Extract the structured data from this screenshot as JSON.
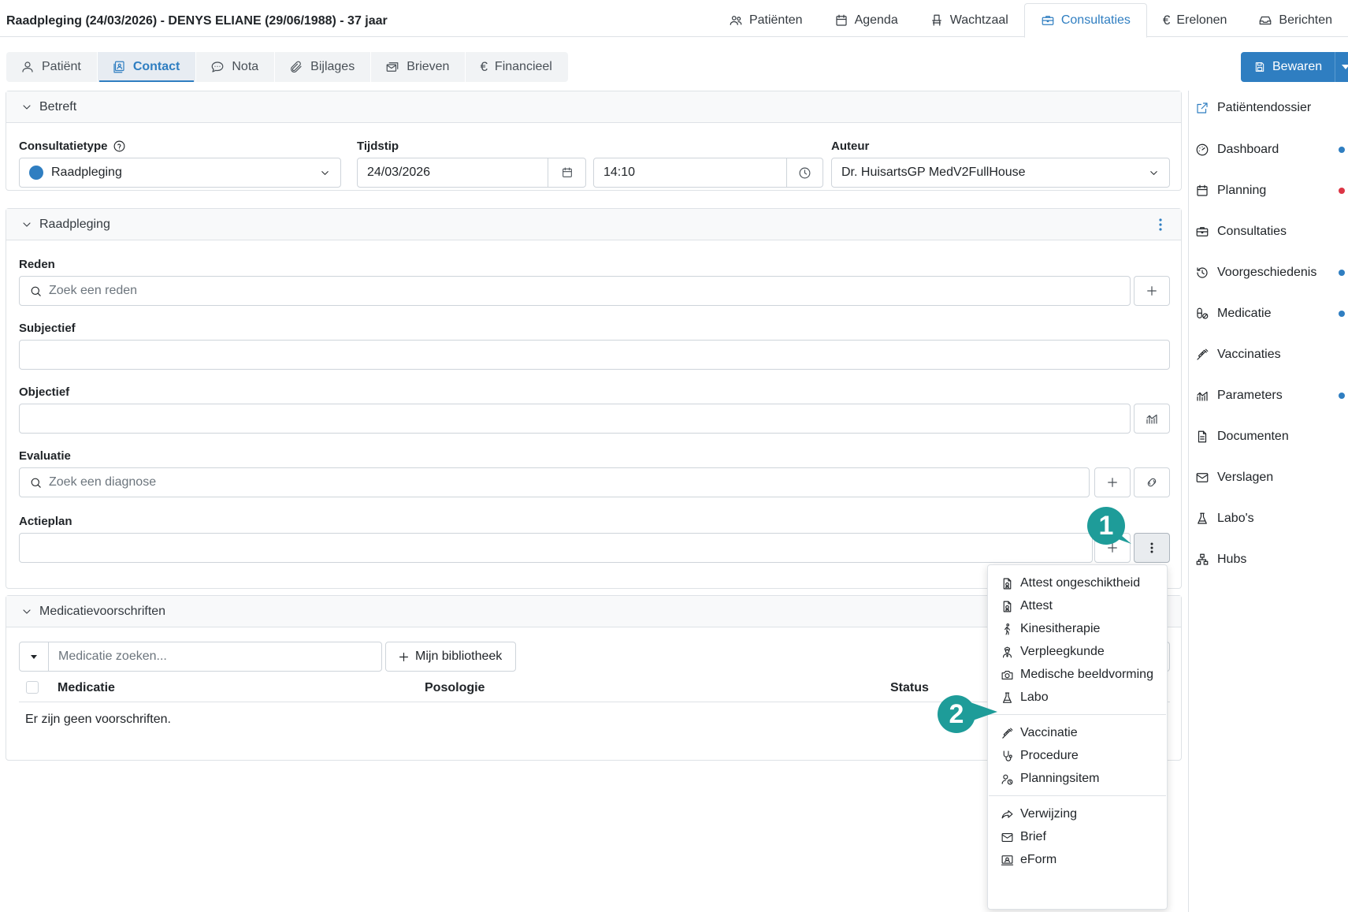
{
  "header": {
    "title": "Raadpleging (24/03/2026) - DENYS ELIANE (29/06/1988) - 37 jaar",
    "nav": [
      {
        "label": "Patiënten",
        "icon": "users-icon"
      },
      {
        "label": "Agenda",
        "icon": "calendar-icon"
      },
      {
        "label": "Wachtzaal",
        "icon": "chair-icon"
      },
      {
        "label": "Consultaties",
        "icon": "briefcase-icon",
        "active": true
      },
      {
        "label": "Erelonen",
        "icon": "euro-icon"
      },
      {
        "label": "Berichten",
        "icon": "inbox-icon"
      }
    ]
  },
  "tabs": [
    {
      "label": "Patiënt",
      "icon": "user-icon"
    },
    {
      "label": "Contact",
      "icon": "contact-icon",
      "active": true
    },
    {
      "label": "Nota",
      "icon": "chat-icon"
    },
    {
      "label": "Bijlages",
      "icon": "paperclip-icon"
    },
    {
      "label": "Brieven",
      "icon": "letters-icon"
    },
    {
      "label": "Financieel",
      "icon": "euro-icon"
    }
  ],
  "save": {
    "label": "Bewaren"
  },
  "betreft": {
    "title": "Betreft",
    "consultatietype_label": "Consultatietype",
    "consultatietype_value": "Raadpleging",
    "consultatietype_color": "#2f7ec1",
    "tijdstip_label": "Tijdstip",
    "date_value": "24/03/2026",
    "time_value": "14:10",
    "auteur_label": "Auteur",
    "auteur_value": "Dr. HuisartsGP MedV2FullHouse"
  },
  "raadpleging": {
    "title": "Raadpleging",
    "reden_label": "Reden",
    "reden_placeholder": "Zoek een reden",
    "subjectief_label": "Subjectief",
    "objectief_label": "Objectief",
    "evaluatie_label": "Evaluatie",
    "evaluatie_placeholder": "Zoek een diagnose",
    "actieplan_label": "Actieplan"
  },
  "medicatie": {
    "title": "Medicatievoorschriften",
    "search_placeholder": "Medicatie zoeken...",
    "library_label": "Mijn bibliotheek",
    "columns": {
      "medicatie": "Medicatie",
      "posologie": "Posologie",
      "status": "Status"
    },
    "empty": "Er zijn geen voorschriften."
  },
  "sidebar": {
    "items": [
      {
        "label": "Patiëntendossier",
        "icon": "external-link-icon"
      },
      {
        "label": "Dashboard",
        "icon": "gauge-icon",
        "dot": "#2f7ec1"
      },
      {
        "label": "Planning",
        "icon": "calendar-icon",
        "dot": "#dc3545"
      },
      {
        "label": "Consultaties",
        "icon": "briefcase-icon"
      },
      {
        "label": "Voorgeschiedenis",
        "icon": "history-icon",
        "dot": "#2f7ec1"
      },
      {
        "label": "Medicatie",
        "icon": "pills-icon",
        "dot": "#2f7ec1"
      },
      {
        "label": "Vaccinaties",
        "icon": "syringe-icon"
      },
      {
        "label": "Parameters",
        "icon": "chart-icon",
        "dot": "#2f7ec1"
      },
      {
        "label": "Documenten",
        "icon": "document-icon"
      },
      {
        "label": "Verslagen",
        "icon": "envelope-icon"
      },
      {
        "label": "Labo's",
        "icon": "flask-icon"
      },
      {
        "label": "Hubs",
        "icon": "hubs-icon"
      }
    ]
  },
  "menu": {
    "items": [
      {
        "label": "Attest ongeschiktheid",
        "icon": "certificate-icon"
      },
      {
        "label": "Attest",
        "icon": "certificate-icon"
      },
      {
        "label": "Kinesitherapie",
        "icon": "walking-icon"
      },
      {
        "label": "Verpleegkunde",
        "icon": "nurse-icon"
      },
      {
        "label": "Medische beeldvorming",
        "icon": "camera-icon"
      },
      {
        "label": "Labo",
        "icon": "flask-icon"
      },
      {
        "label": "Vaccinatie",
        "icon": "syringe-icon"
      },
      {
        "label": "Procedure",
        "icon": "stethoscope-icon"
      },
      {
        "label": "Planningsitem",
        "icon": "user-clock-icon"
      },
      {
        "label": "Verwijzing",
        "icon": "share-icon"
      },
      {
        "label": "Brief",
        "icon": "envelope-icon"
      },
      {
        "label": "eForm",
        "icon": "eform-icon"
      }
    ]
  },
  "callouts": [
    "1",
    "2"
  ],
  "colors": {
    "accent": "#2f7ec1",
    "callout": "#1e9c99"
  }
}
